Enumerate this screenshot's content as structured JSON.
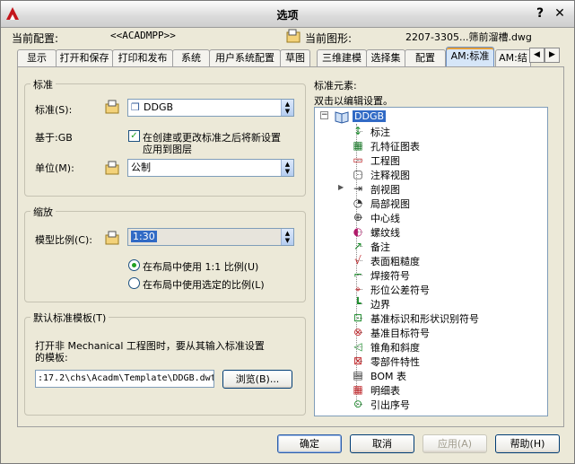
{
  "window": {
    "title": "选项"
  },
  "header": {
    "profile_label": "当前配置:",
    "profile_value": "<<ACADMPP>>",
    "drawing_label": "当前图形:",
    "drawing_value": "2207-3305...筛前溜槽.dwg"
  },
  "tabs": [
    {
      "label": "显示"
    },
    {
      "label": "打开和保存"
    },
    {
      "label": "打印和发布"
    },
    {
      "label": "系统"
    },
    {
      "label": "用户系统配置"
    },
    {
      "label": "草图"
    },
    {
      "label": "三维建模"
    },
    {
      "label": "选择集"
    },
    {
      "label": "配置"
    },
    {
      "label": "AM:标准",
      "active": true
    },
    {
      "label": "AM:结"
    }
  ],
  "standard_group": {
    "title": "标准",
    "standard_label": "标准(S):",
    "standard_value": "DDGB",
    "based_on": "基于:GB",
    "checkbox_label_line1": "在创建或更改标准之后将新设置",
    "checkbox_label_line2": "应用到图层",
    "checkbox_checked": true,
    "unit_label": "单位(M):",
    "unit_value": "公制"
  },
  "scale_group": {
    "title": "缩放",
    "model_scale_label": "模型比例(C):",
    "model_scale_value": "1:30",
    "radio1_label": "在布局中使用 1:1 比例(U)",
    "radio2_label": "在布局中使用选定的比例(L)",
    "selected_radio": 1
  },
  "template_group": {
    "title": "默认标准模板(T)",
    "desc_line1": "打开非 Mechanical 工程图时，要从其输入标准设置",
    "desc_line2": "的模板:",
    "path_value": ":17.2\\chs\\Acadm\\Template\\DDGB.dwt",
    "browse_label": "浏览(B)..."
  },
  "elements": {
    "label": "标准元素:",
    "hint": "双击以编辑设置。",
    "root": "DDGB",
    "items": [
      {
        "label": "标注",
        "icon": "dimension-icon"
      },
      {
        "label": "孔特征图表",
        "icon": "hole-chart-icon"
      },
      {
        "label": "工程图",
        "icon": "drawing-view-icon"
      },
      {
        "label": "注释视图",
        "icon": "annotation-view-icon"
      },
      {
        "label": "剖视图",
        "icon": "section-view-icon",
        "expandable": true
      },
      {
        "label": "局部视图",
        "icon": "detail-view-icon"
      },
      {
        "label": "中心线",
        "icon": "centerline-icon"
      },
      {
        "label": "螺纹线",
        "icon": "thread-icon"
      },
      {
        "label": "备注",
        "icon": "note-icon"
      },
      {
        "label": "表面粗糙度",
        "icon": "surface-texture-icon"
      },
      {
        "label": "焊接符号",
        "icon": "weld-symbol-icon"
      },
      {
        "label": "形位公差符号",
        "icon": "fcf-icon"
      },
      {
        "label": "边界",
        "icon": "border-icon"
      },
      {
        "label": "基准标识和形状识别符号",
        "icon": "datum-id-icon"
      },
      {
        "label": "基准目标符号",
        "icon": "datum-target-icon"
      },
      {
        "label": "锥角和斜度",
        "icon": "taper-slope-icon"
      },
      {
        "label": "零部件特性",
        "icon": "part-property-icon"
      },
      {
        "label": "BOM 表",
        "icon": "bom-icon"
      },
      {
        "label": "明细表",
        "icon": "parts-list-icon"
      },
      {
        "label": "引出序号",
        "icon": "balloon-icon"
      }
    ]
  },
  "buttons": {
    "ok": "确定",
    "cancel": "取消",
    "apply": "应用(A)",
    "help": "帮助(H)"
  },
  "colors": {
    "accent": "#316ac5",
    "tab_active": "#d6e6f8"
  }
}
